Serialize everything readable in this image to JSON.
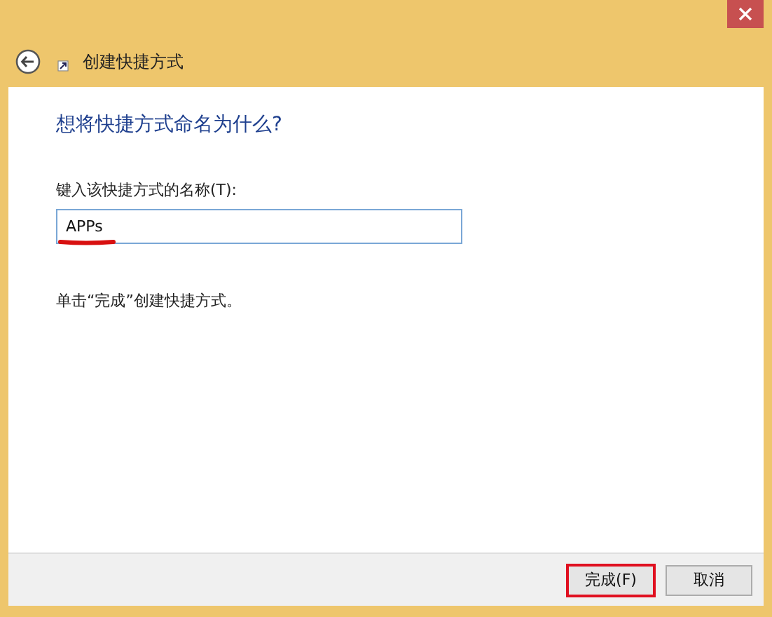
{
  "window": {
    "title": "创建快捷方式"
  },
  "heading": "想将快捷方式命名为什么?",
  "name_field": {
    "label": "键入该快捷方式的名称(T):",
    "value": "APPs"
  },
  "instruction": "单击“完成”创建快捷方式。",
  "buttons": [
    {
      "label": "完成(F)",
      "highlighted": true
    },
    {
      "label": "取消",
      "highlighted": false
    }
  ]
}
